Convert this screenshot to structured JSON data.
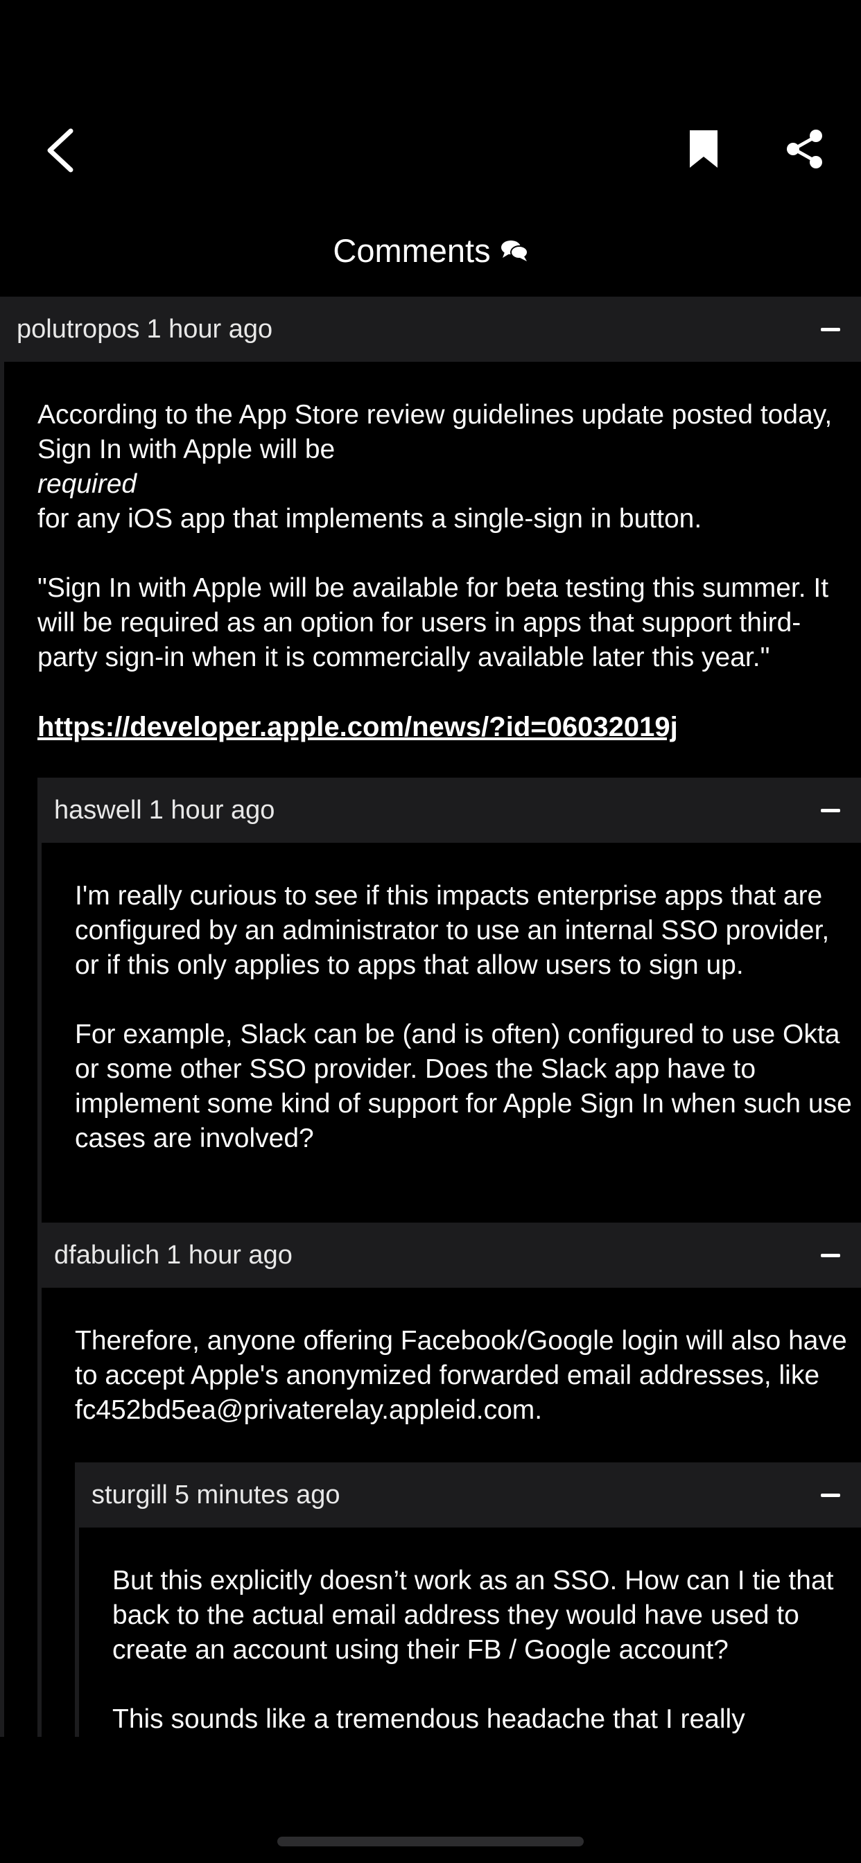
{
  "title": "Comments",
  "icons": {
    "back": "chevron-left-icon",
    "bookmark": "bookmark-icon",
    "share": "share-icon",
    "comments": "speech-bubbles-icon",
    "collapse": "minus-icon"
  },
  "comments": [
    {
      "author": "polutropos",
      "time": "1 hour ago",
      "p1_a": "According to the App Store review guidelines update posted today, Sign In with Apple will be",
      "p1_em": "required",
      "p1_b": "for any iOS app that implements a single-sign in button.",
      "p2": "\"Sign In with Apple will be available for beta testing this summer. It will be required as an option for users in apps that support third-party sign-in when it is commercially available later this year.\"",
      "link": "https://developer.apple.com/news/?id=06032019j"
    },
    {
      "author": "haswell",
      "time": "1 hour ago",
      "p1": "I'm really curious to see if this impacts enterprise apps that are configured by an administrator to use an internal SSO provider, or if this only applies to apps that allow users to sign up.",
      "p2": "For example, Slack can be (and is often) configured to use Okta or some other SSO provider. Does the Slack app have to implement some kind of support for Apple Sign In when such use cases are involved?"
    },
    {
      "author": "dfabulich",
      "time": "1 hour ago",
      "p1": "Therefore, anyone offering Facebook/Google login will also have to accept Apple's anonymized forwarded email addresses, like fc452bd5ea@privaterelay.appleid.com."
    },
    {
      "author": "sturgill",
      "time": "5 minutes ago",
      "p1": "But this explicitly doesn’t work as an SSO. How can I tie that back to the actual email address they would have used to create an account using their FB / Google account?",
      "p2": "This sounds like a tremendous headache that I really"
    }
  ]
}
